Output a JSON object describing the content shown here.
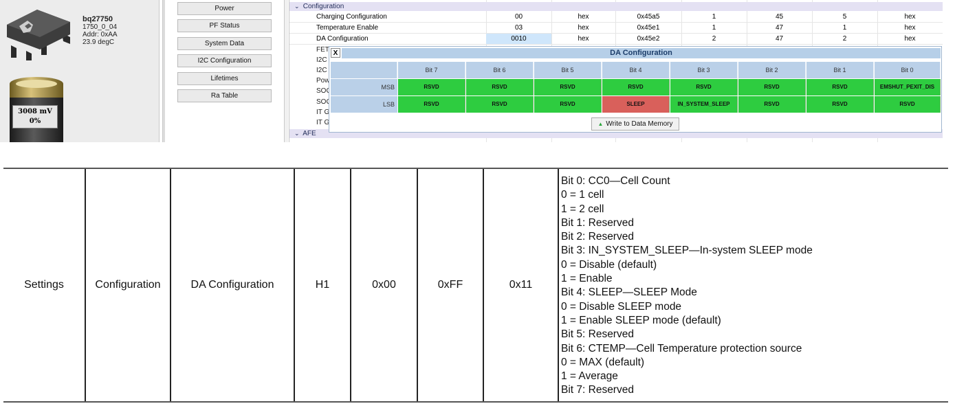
{
  "device": {
    "name": "bq27750",
    "firmware": "1750_0_04",
    "address": "Addr: 0xAA",
    "temperature": "23.9 degC",
    "voltage": "3008 mV",
    "percent": "0%"
  },
  "nav": {
    "buttons": [
      "Power",
      "PF Status",
      "System Data",
      "I2C Configuration",
      "Lifetimes",
      "Ra Table"
    ]
  },
  "grid": {
    "configuration_header": "Configuration",
    "afe_header": "AFE",
    "rows": [
      {
        "name": "Charging Configuration",
        "value": "00",
        "unit": "hex",
        "address": "0x45a5",
        "size": "1",
        "subclass": "45",
        "offset": "5",
        "format": "hex"
      },
      {
        "name": "Temperature Enable",
        "value": "03",
        "unit": "hex",
        "address": "0x45e1",
        "size": "1",
        "subclass": "47",
        "offset": "1",
        "format": "hex"
      },
      {
        "name": "DA Configuration",
        "value": "0010",
        "unit": "hex",
        "address": "0x45e2",
        "size": "2",
        "subclass": "47",
        "offset": "2",
        "format": "hex"
      }
    ],
    "truncated_labels": [
      "FET",
      "I2C",
      "I2C",
      "Pow",
      "SOC",
      "SOC",
      "IT G",
      "IT G"
    ]
  },
  "popup": {
    "close_label": "X",
    "title": "DA Configuration",
    "bit_headers": [
      "Bit 7",
      "Bit 6",
      "Bit 5",
      "Bit 4",
      "Bit 3",
      "Bit 2",
      "Bit 1",
      "Bit 0"
    ],
    "msb_label": "MSB",
    "lsb_label": "LSB",
    "msb_bits": [
      "RSVD",
      "RSVD",
      "RSVD",
      "RSVD",
      "RSVD",
      "RSVD",
      "RSVD",
      "EMSHUT_PEXIT_DIS"
    ],
    "lsb_bits": [
      "RSVD",
      "RSVD",
      "RSVD",
      "SLEEP",
      "IN_SYSTEM_SLEEP",
      "RSVD",
      "RSVD",
      "RSVD"
    ],
    "lsb_set_bit": "SLEEP",
    "write_button": "Write to Data Memory"
  },
  "colors": {
    "bit_clear": "#2ecc40",
    "bit_set": "#d9605b",
    "header_blue": "#bad0e8",
    "section_header": "#e4e1f3"
  },
  "spec_row": {
    "class": "Settings",
    "subclass": "Configuration",
    "name": "DA Configuration",
    "type": "H1",
    "min": "0x00",
    "max": "0xFF",
    "default": "0x11",
    "description": [
      "Bit 0: CC0—Cell Count",
      "0 = 1 cell",
      "1 = 2 cell",
      "Bit 1: Reserved",
      "Bit 2: Reserved",
      "Bit 3: IN_SYSTEM_SLEEP—In-system SLEEP mode",
      "0 = Disable (default)",
      "1 = Enable",
      "Bit 4: SLEEP—SLEEP Mode",
      "0 = Disable SLEEP mode",
      "1 = Enable SLEEP mode (default)",
      "Bit 5: Reserved",
      "Bit 6: CTEMP—Cell Temperature protection source",
      "0 = MAX (default)",
      "1 = Average",
      "Bit 7: Reserved"
    ]
  }
}
